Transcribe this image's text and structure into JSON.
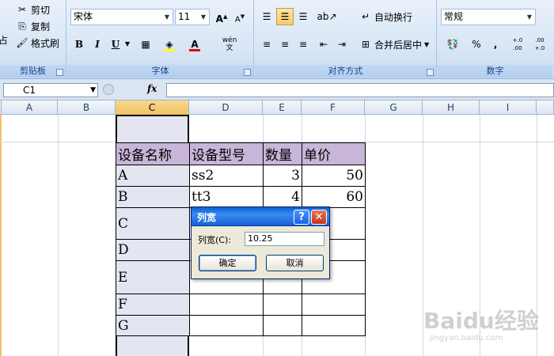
{
  "ribbon": {
    "clipboard": {
      "cut": "剪切",
      "copy": "复制",
      "format_painter": "格式刷",
      "paste_partial": "占",
      "label": "剪贴板"
    },
    "font": {
      "name": "宋体",
      "size": "11",
      "label": "字体",
      "bold": "B",
      "italic": "I",
      "underline": "U",
      "font_color_letter": "A",
      "grow": "A",
      "shrink": "A",
      "phonetic": "wén"
    },
    "alignment": {
      "wrap_text": "自动换行",
      "merge_center": "合并后居中",
      "label": "对齐方式"
    },
    "number": {
      "format": "常规",
      "percent": "%",
      "comma": ",",
      "inc_decimal": "+.0 .00",
      "dec_decimal": ".00 +.0",
      "label": "数字"
    }
  },
  "formula_bar": {
    "name_box": "C1",
    "fx": "fx",
    "content": ""
  },
  "columns": [
    "A",
    "B",
    "C",
    "D",
    "E",
    "F",
    "G",
    "H",
    "I"
  ],
  "selected_column": "C",
  "table": {
    "headers": [
      "设备名称",
      "设备型号",
      "数量",
      "单价"
    ],
    "rows": [
      {
        "name": "A",
        "model": "ss2",
        "qty": "3",
        "price": "50"
      },
      {
        "name": "B",
        "model": "tt3",
        "qty": "4",
        "price": "60"
      },
      {
        "name": "C",
        "model": "",
        "qty": "",
        "price": ""
      },
      {
        "name": "D",
        "model": "",
        "qty": "",
        "price": ""
      },
      {
        "name": "E",
        "model": "",
        "qty": "",
        "price": ""
      },
      {
        "name": "F",
        "model": "",
        "qty": "",
        "price": ""
      },
      {
        "name": "G",
        "model": "",
        "qty": "",
        "price": ""
      }
    ]
  },
  "dialog": {
    "title": "列宽",
    "help": "?",
    "close": "✕",
    "label": "列宽(C):",
    "value": "10.25",
    "ok": "确定",
    "cancel": "取消"
  },
  "watermark": {
    "main": "Baidu经验",
    "sub": "jingyan.baidu.com"
  },
  "colors": {
    "ribbon_bg": "#d9e6f6",
    "header_fill": "#c7b6d8",
    "selected_column_fill": "#e3e6f1",
    "dialog_title": "#0a5fd8"
  }
}
